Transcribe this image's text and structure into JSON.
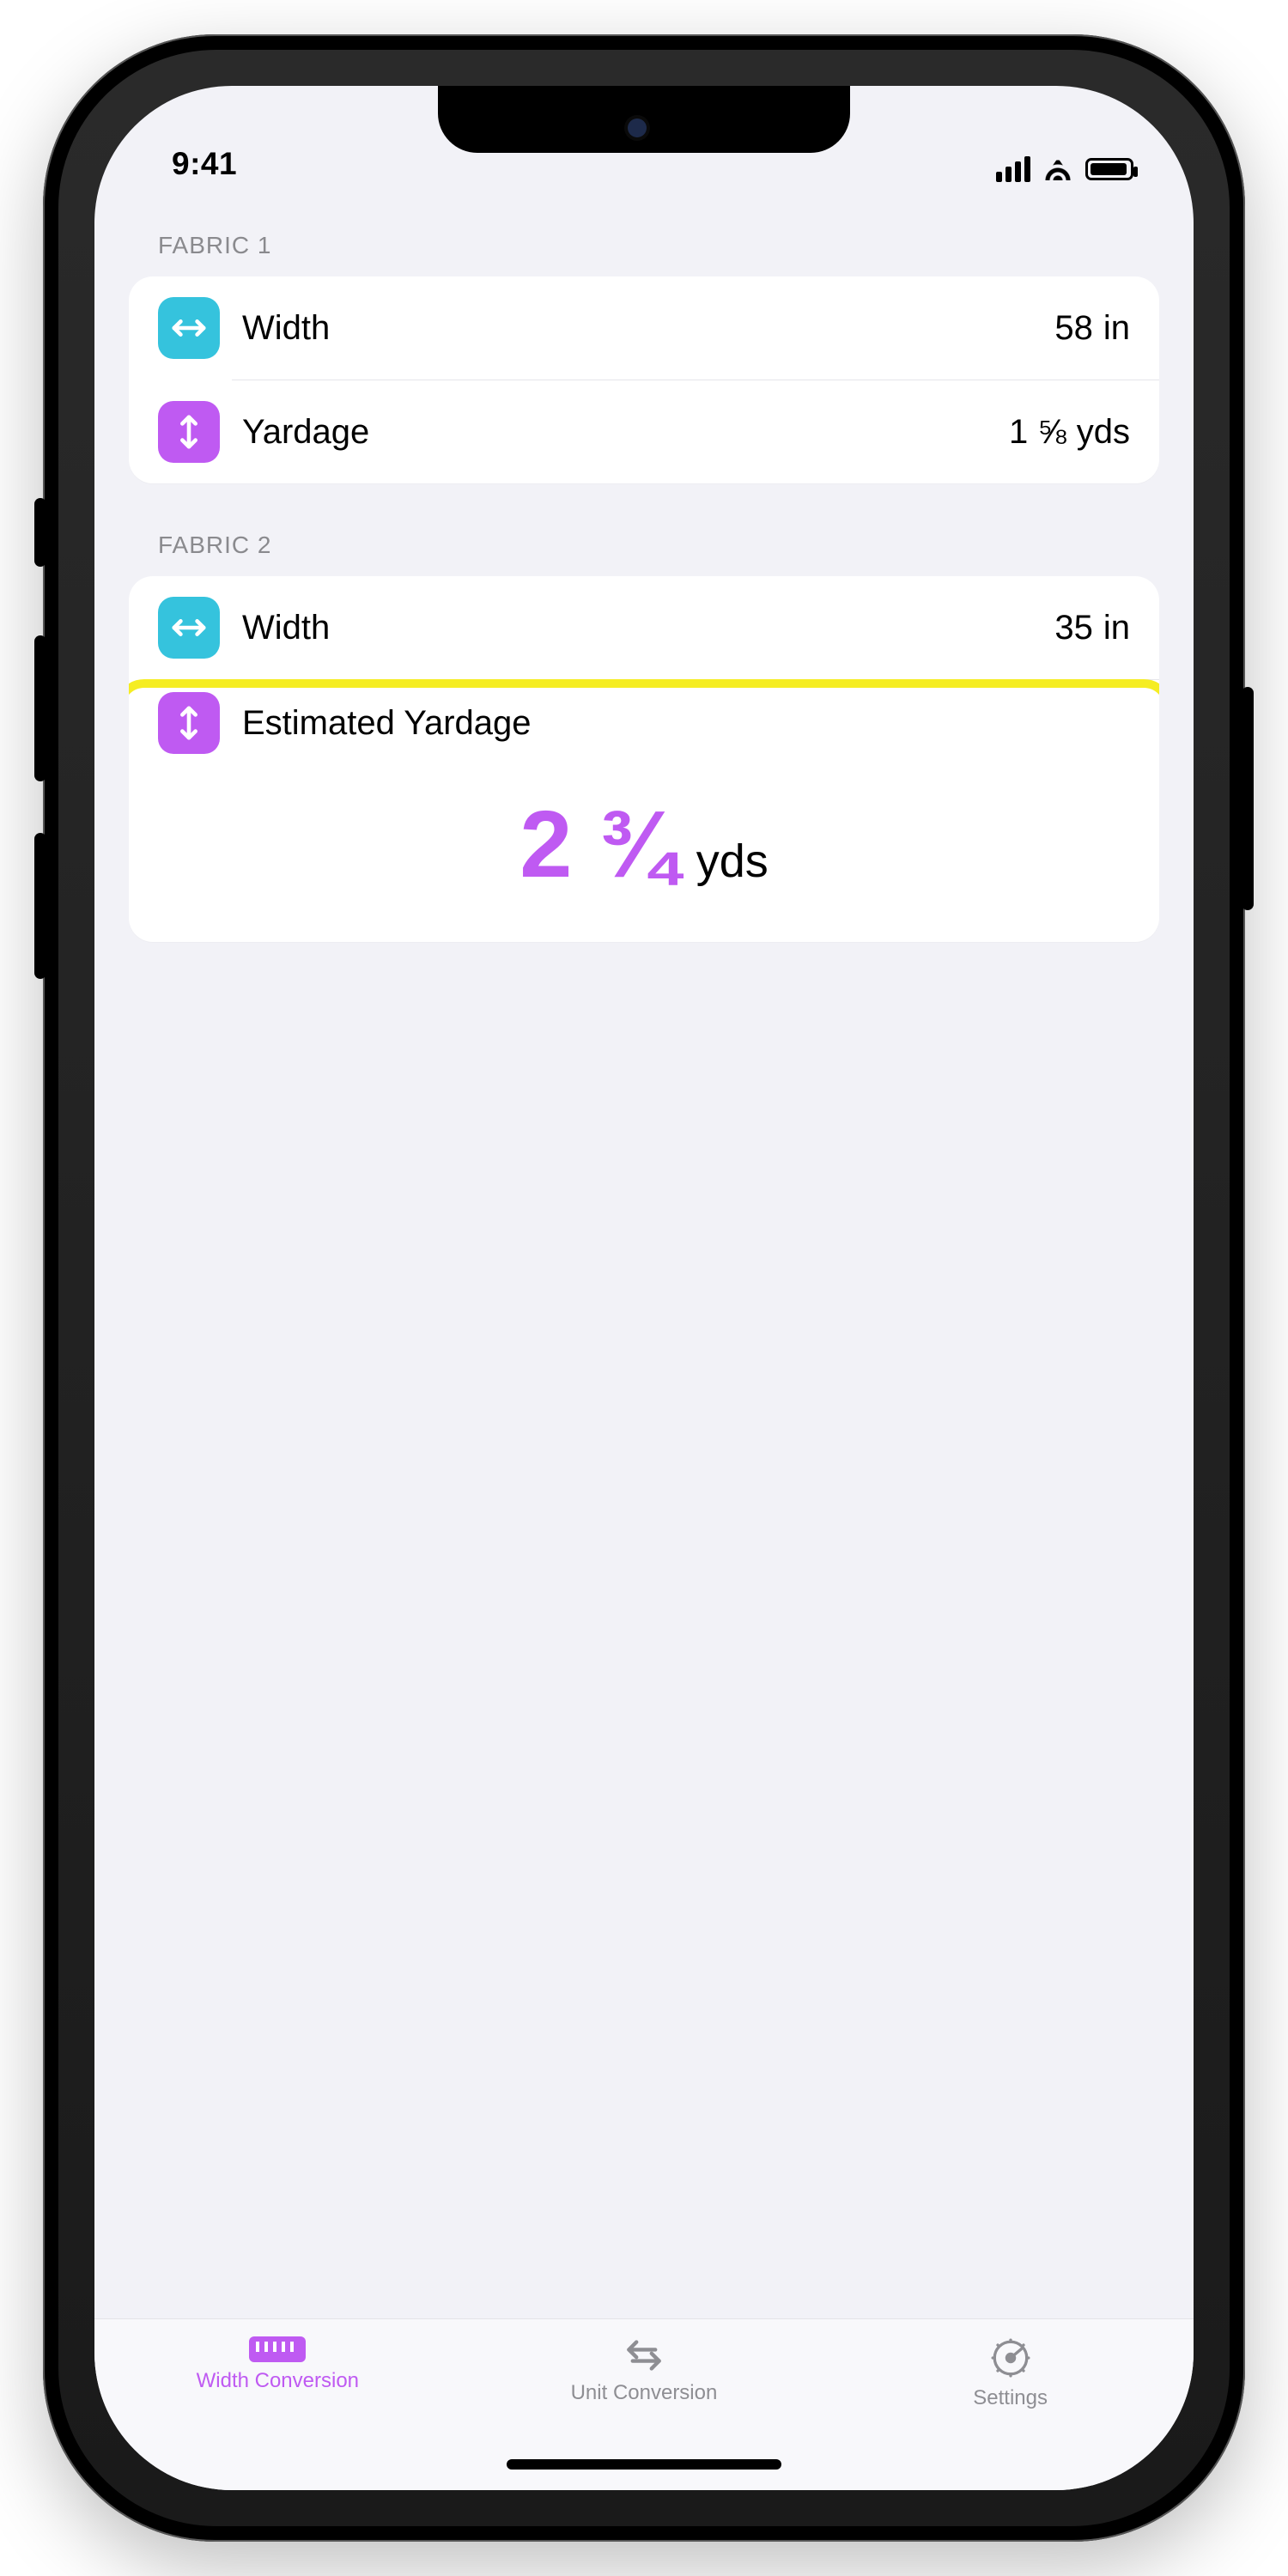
{
  "status": {
    "time": "9:41"
  },
  "sections": {
    "fabric1": {
      "header": "FABRIC 1",
      "width_label": "Width",
      "width_value": "58",
      "width_unit": "in",
      "yardage_label": "Yardage",
      "yardage_value": "1 ⅝",
      "yardage_unit": "yds"
    },
    "fabric2": {
      "header": "FABRIC 2",
      "width_label": "Width",
      "width_value": "35",
      "width_unit": "in",
      "est_label": "Estimated Yardage",
      "est_value": "2 ¾",
      "est_unit": "yds"
    }
  },
  "tabs": {
    "width": "Width Conversion",
    "unit": "Unit Conversion",
    "settings": "Settings"
  }
}
